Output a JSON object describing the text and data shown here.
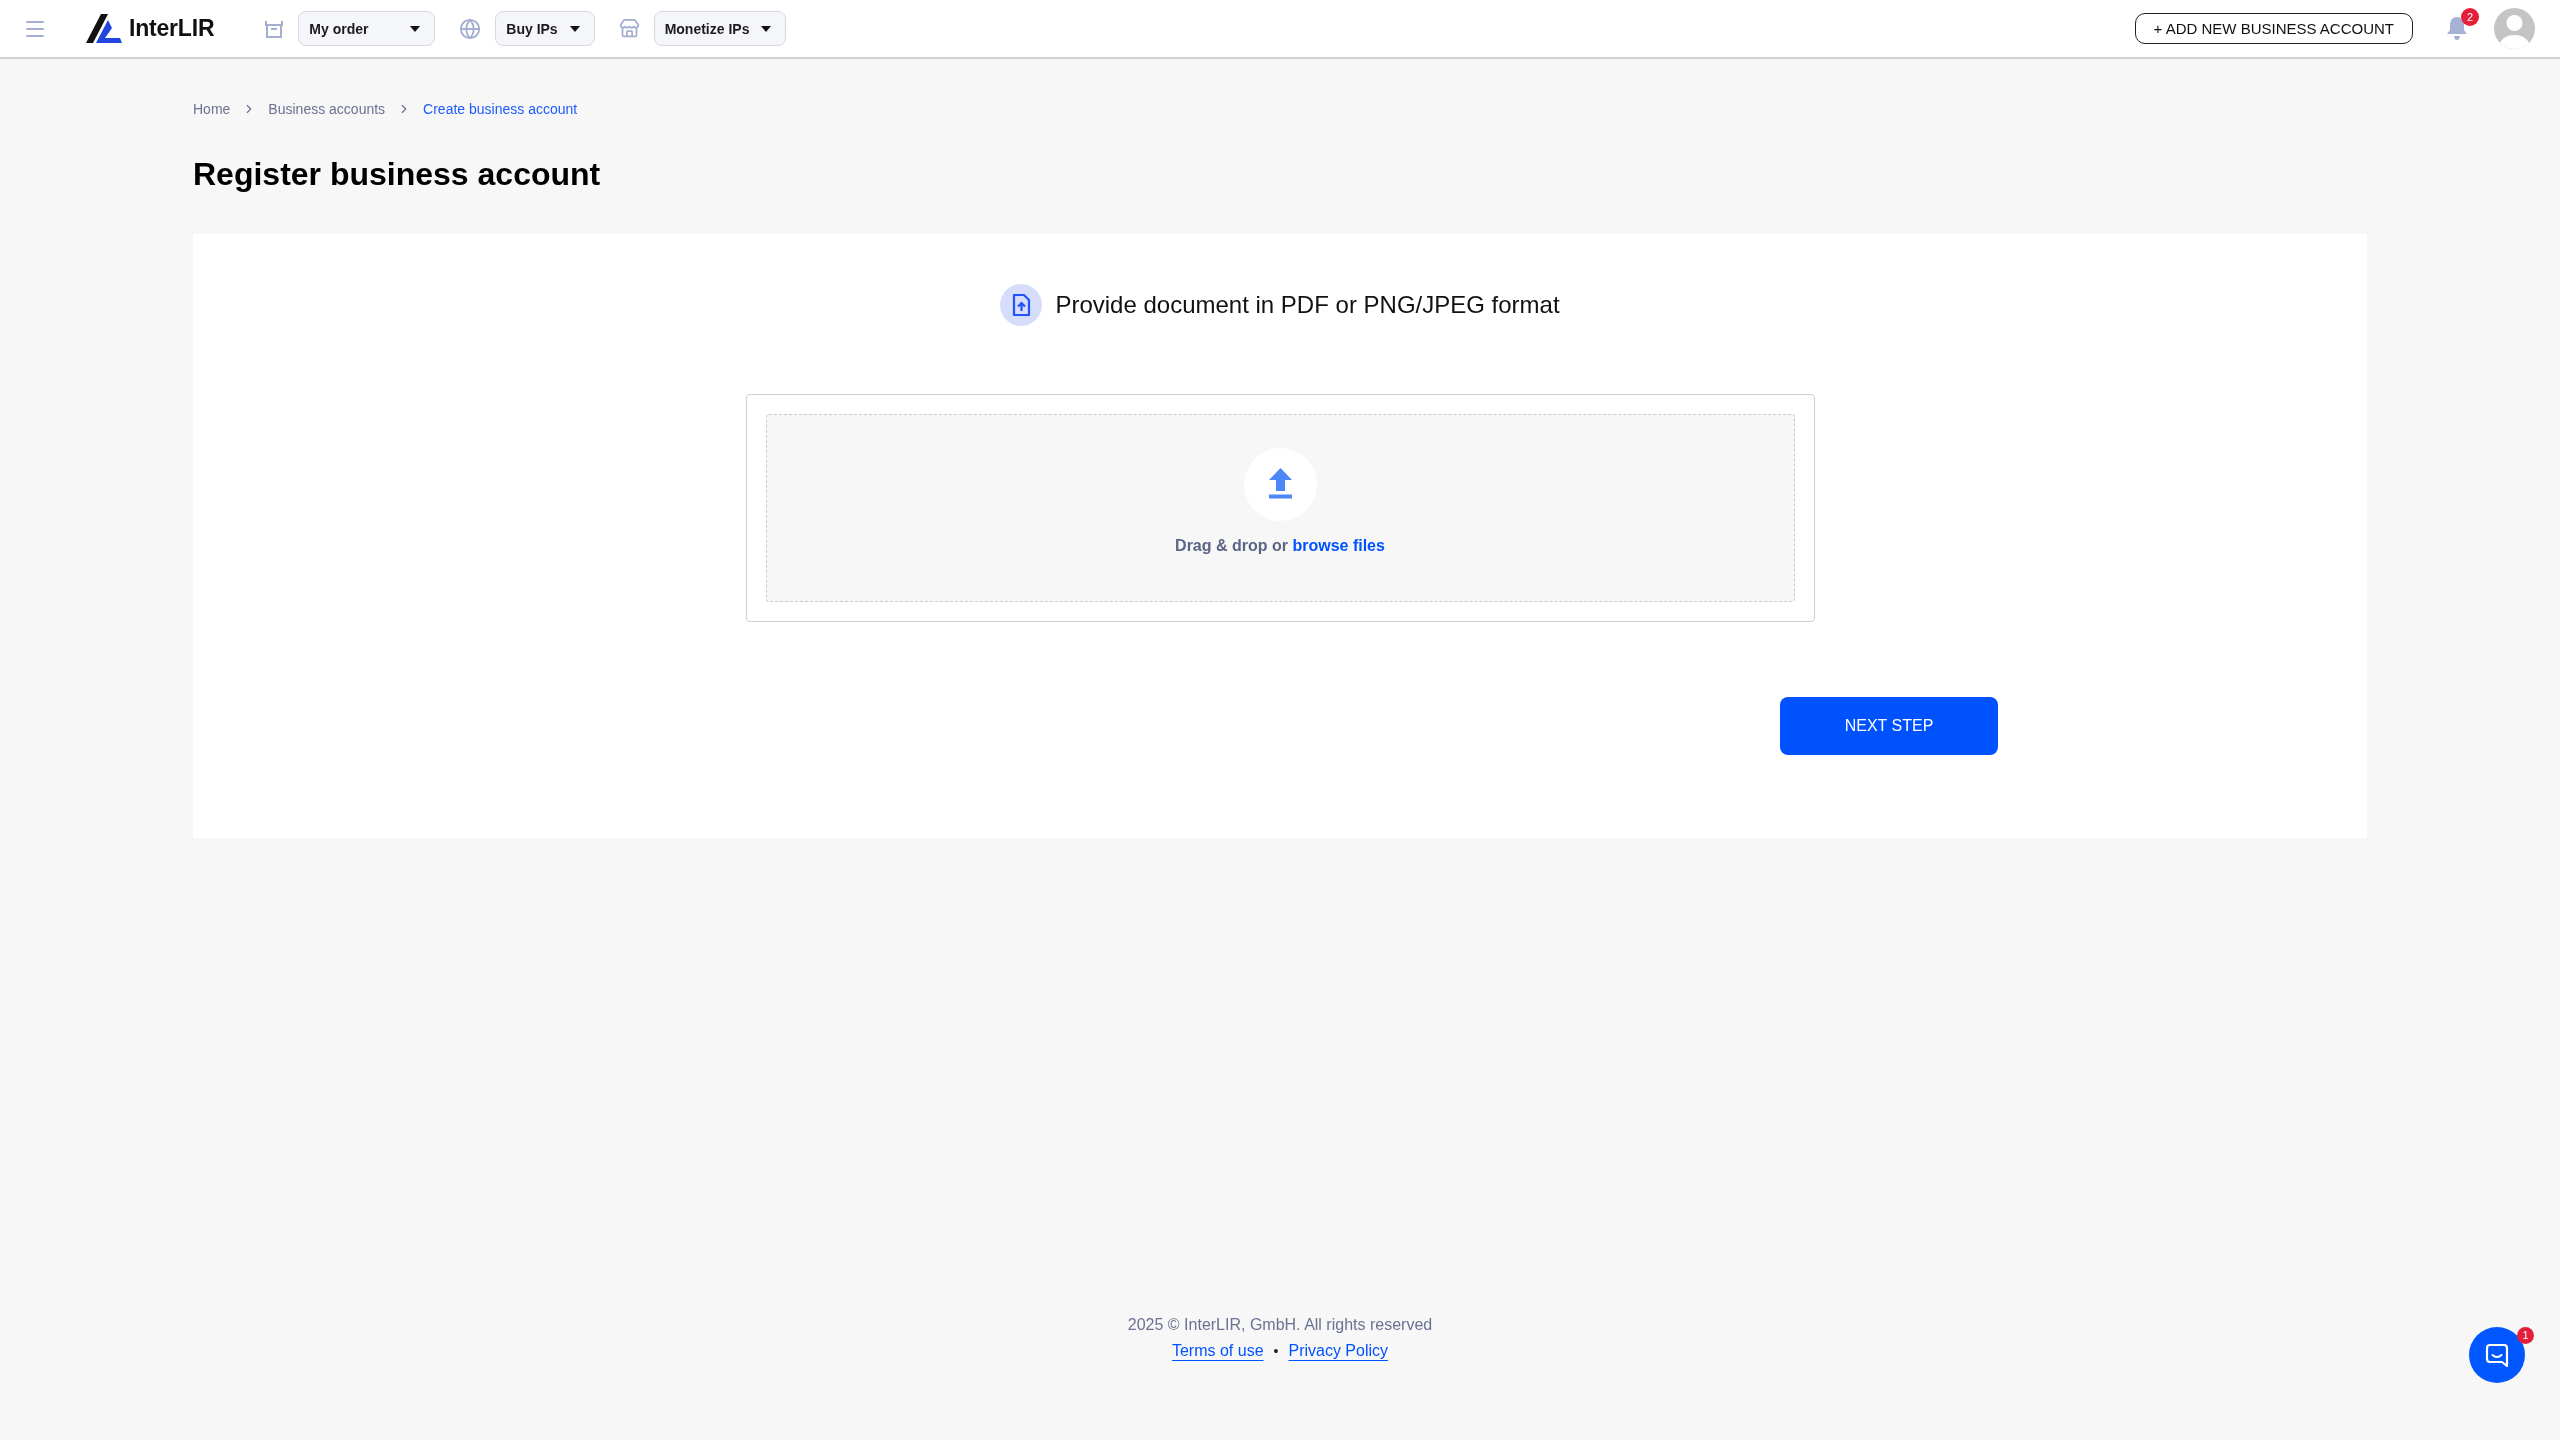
{
  "header": {
    "brand": "InterLIR",
    "menus": [
      {
        "label": "My order"
      },
      {
        "label": "Buy IPs"
      },
      {
        "label": "Monetize IPs"
      }
    ],
    "add_account_button": "+ ADD NEW BUSINESS ACCOUNT",
    "notifications_badge": "2"
  },
  "breadcrumb": [
    {
      "label": "Home",
      "selected": false
    },
    {
      "label": "Business accounts",
      "selected": false
    },
    {
      "label": "Create business account",
      "selected": true
    }
  ],
  "page_title": "Register business account",
  "upload": {
    "heading": "Provide document in PDF or PNG/JPEG format",
    "prompt": "Drag & drop or",
    "browse_link": "browse files"
  },
  "next_button": "NEXT STEP",
  "footer": {
    "copyright": "2025 © InterLIR, GmbH. All rights reserved",
    "links": [
      "Terms of use",
      "Privacy Policy"
    ],
    "separator": "•"
  },
  "chat": {
    "badge": "1"
  }
}
